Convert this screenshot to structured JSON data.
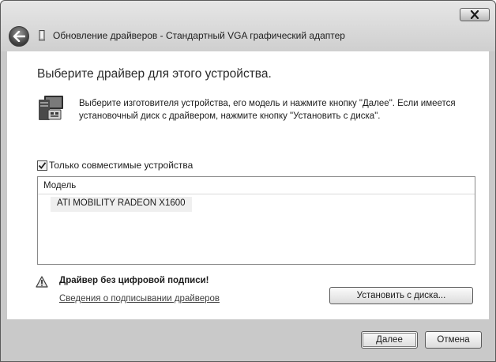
{
  "window": {
    "title": "Обновление драйверов - Стандартный VGA графический адаптер"
  },
  "content": {
    "heading": "Выберите драйвер для этого устройства.",
    "instructions": "Выберите изготовителя устройства, его модель и нажмите кнопку \"Далее\". Если имеется установочный диск с  драйвером, нажмите кнопку \"Установить с диска\".",
    "compatible_checkbox": {
      "label": "Только совместимые устройства",
      "checked": true
    },
    "model_list": {
      "header": "Модель",
      "items": [
        "ATI MOBILITY RADEON X1600"
      ]
    },
    "warning": {
      "text": "Драйвер без цифровой подписи!",
      "link": "Сведения о подписывании драйверов"
    },
    "install_button": "Установить с диска..."
  },
  "footer": {
    "next_button": "Далее",
    "cancel_button": "Отмена"
  },
  "icons": {
    "close": "close-icon",
    "back": "back-arrow-icon",
    "title": "device-icon",
    "monitor": "monitor-icon",
    "warning": "warning-icon"
  }
}
